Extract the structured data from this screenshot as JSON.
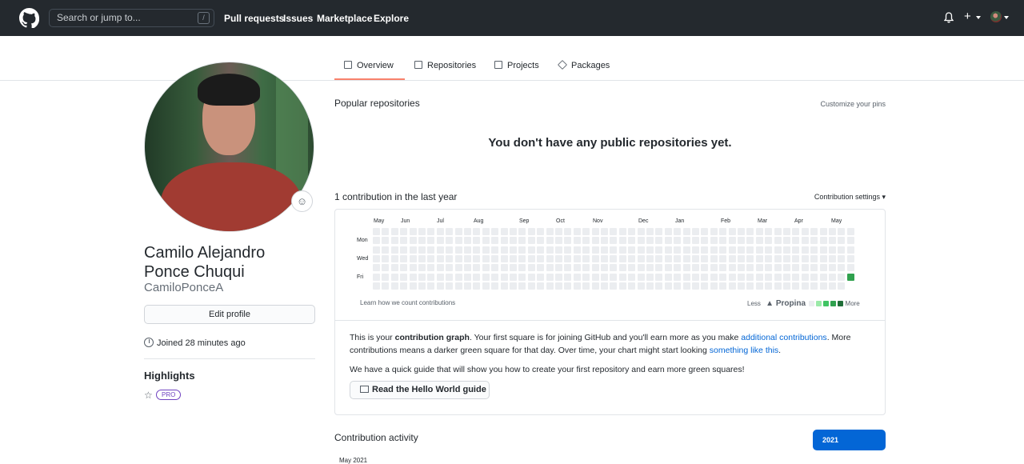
{
  "header": {
    "search_placeholder": "Search or jump to...",
    "search_shortcut": "/",
    "nav": [
      "Pull requests",
      "Issues",
      "Marketplace",
      "Explore"
    ],
    "plus": "+"
  },
  "tabs": [
    "Overview",
    "Repositories",
    "Projects",
    "Packages"
  ],
  "profile": {
    "name_line1": "Camilo Alejandro",
    "name_line2": "Ponce Chuqui",
    "username": "CamiloPonceA",
    "edit_button": "Edit profile",
    "joined": "Joined 28 minutes ago",
    "highlights_title": "Highlights",
    "badge": "PRO",
    "emoji": "☺"
  },
  "popular": {
    "title": "Popular repositories",
    "customize": "Customize your pins",
    "empty": "You don't have any public repositories yet."
  },
  "contrib": {
    "title": "1 contribution in the last year",
    "settings": "Contribution settings ▾",
    "months": [
      "May",
      "Jun",
      "Jul",
      "Aug",
      "Sep",
      "Oct",
      "Nov",
      "Dec",
      "Jan",
      "Feb",
      "Mar",
      "Apr",
      "May"
    ],
    "days": [
      "Mon",
      "Wed",
      "Fri"
    ],
    "learn": "Learn how we count contributions",
    "less": "Less",
    "propina": "Propina",
    "more": "More",
    "colors": [
      "#ebedf0",
      "#9be9a8",
      "#40c463",
      "#30a14e",
      "#216e39"
    ],
    "weeks": 53,
    "last_week_days": 5,
    "active": {
      "week": 52,
      "day": 5,
      "level": 3
    },
    "info1_a": "This is your ",
    "info1_b": "contribution graph",
    "info1_c": ". Your first square is for joining GitHub and you'll earn more as you make ",
    "info1_link1": "additional contributions",
    "info1_d": ". More",
    "info2_a": "contributions means a darker green square for that day. Over time, your chart might start looking ",
    "info2_link": "something like this",
    "info2_b": ".",
    "info3": "We have a quick guide that will show you how to create your first repository and earn more green squares!",
    "guide_button": "Read the Hello World guide"
  },
  "activity": {
    "title": "Contribution activity",
    "year": "2021",
    "period": "May 2021"
  }
}
